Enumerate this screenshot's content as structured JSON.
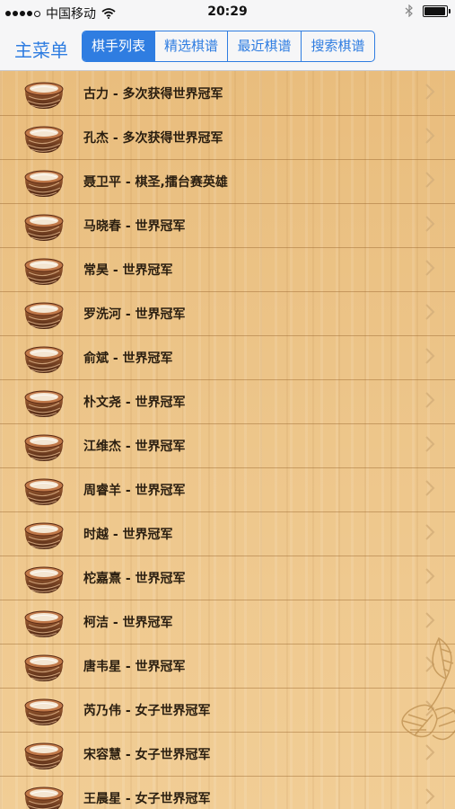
{
  "status_bar": {
    "carrier": "中国移动",
    "time": "20:29",
    "signal_bars": 4,
    "battery_level": 0.95
  },
  "nav": {
    "back_label": "主菜单",
    "tabs": [
      {
        "label": "棋手列表",
        "selected": true
      },
      {
        "label": "精选棋谱",
        "selected": false
      },
      {
        "label": "最近棋谱",
        "selected": false
      },
      {
        "label": "搜索棋谱",
        "selected": false
      }
    ]
  },
  "players": [
    {
      "label": "古力 - 多次获得世界冠军"
    },
    {
      "label": "孔杰 - 多次获得世界冠军"
    },
    {
      "label": "聂卫平 - 棋圣,擂台赛英雄"
    },
    {
      "label": "马晓春 - 世界冠军"
    },
    {
      "label": "常昊 - 世界冠军"
    },
    {
      "label": "罗洗河 - 世界冠军"
    },
    {
      "label": "俞斌 - 世界冠军"
    },
    {
      "label": "朴文尧 - 世界冠军"
    },
    {
      "label": "江维杰 - 世界冠军"
    },
    {
      "label": "周睿羊 - 世界冠军"
    },
    {
      "label": "时越 - 世界冠军"
    },
    {
      "label": "柁嘉熹 - 世界冠军"
    },
    {
      "label": "柯洁 - 世界冠军"
    },
    {
      "label": "唐韦星 - 世界冠军"
    },
    {
      "label": "芮乃伟 - 女子世界冠军"
    },
    {
      "label": "宋容慧 - 女子世界冠军"
    },
    {
      "label": "王晨星 - 女子世界冠军"
    }
  ],
  "icons": {
    "row_icon": "go-stone-bowl-icon",
    "row_accessory": "chevron-right-icon"
  },
  "colors": {
    "accent": "#2f7de1",
    "wood": "#ecc488",
    "row_text": "#2a1e10"
  }
}
